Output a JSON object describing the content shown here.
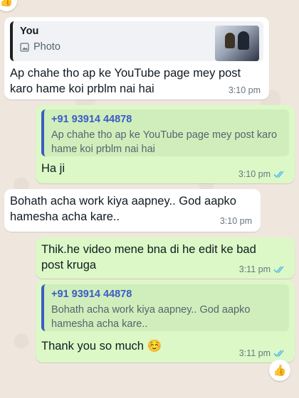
{
  "messages": {
    "m1": {
      "quote_name": "You",
      "quote_media": "Photo",
      "text": "Ap chahe tho ap ke YouTube page mey post karo hame koi prblm nai hai",
      "time": "3:10 pm"
    },
    "m2": {
      "quote_name": "+91 93914 44878",
      "quote_text": "Ap chahe tho ap ke YouTube page mey post karo hame koi prblm nai hai",
      "text": "Ha ji",
      "time": "3:10 pm"
    },
    "m3": {
      "text": "Bohath acha work kiya aapney.. God aapko hamesha acha kare..",
      "time": "3:10 pm"
    },
    "m4": {
      "text": "Thik.he video mene bna di he edit ke bad post kruga",
      "time": "3:11 pm"
    },
    "m5": {
      "quote_name": "+91 93914 44878",
      "quote_text": "Bohath acha work kiya aapney.. God aapko hamesha acha kare..",
      "text": "Thank you so much ☺️",
      "time": "3:11 pm"
    }
  },
  "reactions": {
    "top": "👍",
    "bottom": "👍"
  },
  "colors": {
    "incoming_bubble": "#ffffff",
    "outgoing_bubble": "#dcf8c6",
    "read_ticks": "#53bdeb",
    "quote_name": "#3b5bc7"
  },
  "icons": {
    "photo": "photo-icon",
    "read_receipt": "double-check-icon"
  }
}
